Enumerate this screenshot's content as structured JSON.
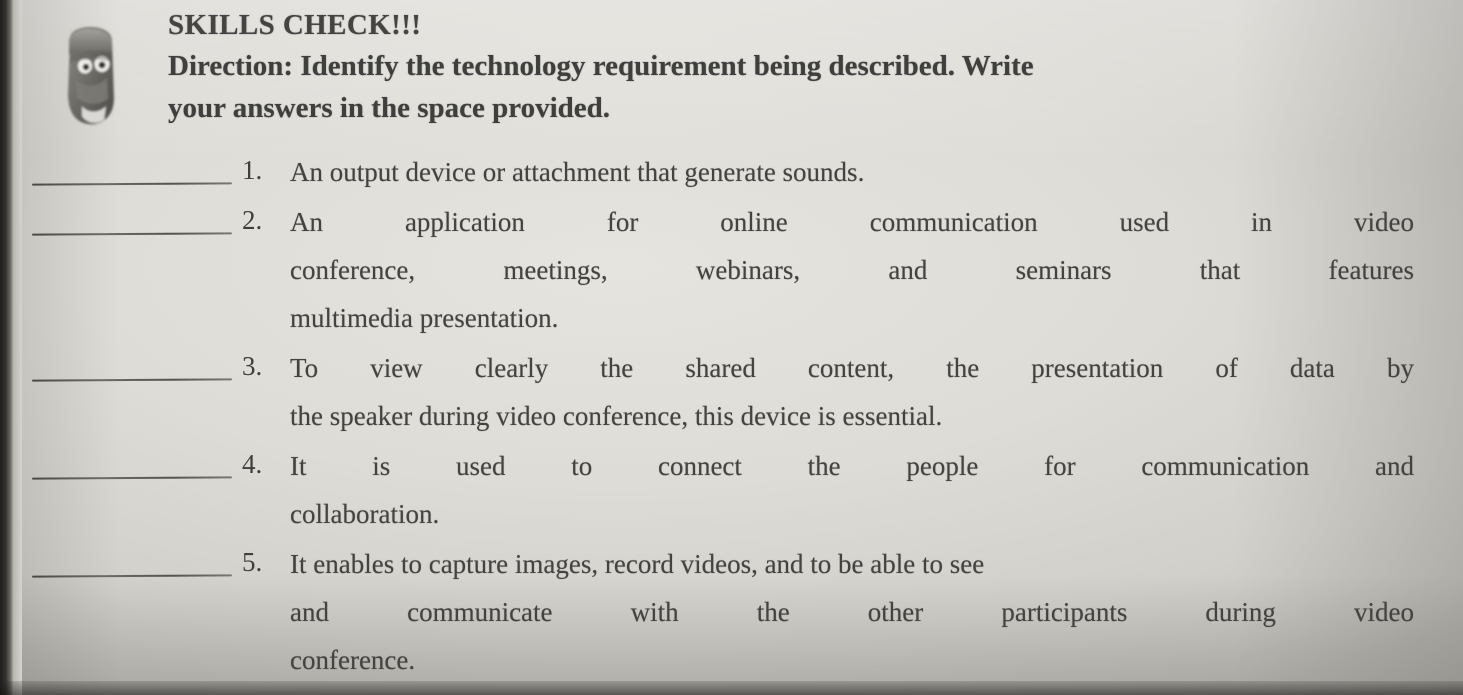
{
  "document": {
    "type": "worksheet-scan",
    "icon_name": "cartoon-character-illustration",
    "title": "SKILLS CHECK!!!",
    "direction": {
      "line1": "Direction: Identify the technology requirement being described. Write",
      "line2": "your answers in the space provided."
    },
    "colors": {
      "paper": "#e1dfda",
      "ink": "#43413e",
      "binding_strip": "#24231f"
    },
    "questions": [
      {
        "number": "1.",
        "answer_blank": "",
        "lines": [
          {
            "text": "An output device or attachment that generate sounds.",
            "justify": false
          }
        ]
      },
      {
        "number": "2.",
        "answer_blank": "",
        "lines": [
          {
            "text": "An application for online communication used in video",
            "justify": true
          },
          {
            "text": "conference, meetings, webinars, and seminars that features",
            "justify": true
          },
          {
            "text": "multimedia presentation.",
            "justify": false
          }
        ]
      },
      {
        "number": "3.",
        "answer_blank": "",
        "lines": [
          {
            "text": "To view clearly the shared content, the presentation of data by",
            "justify": true
          },
          {
            "text": "the speaker during video conference, this device is essential.",
            "justify": false
          }
        ]
      },
      {
        "number": "4.",
        "answer_blank": "",
        "lines": [
          {
            "text": "It is used to connect the people for communication and",
            "justify": true
          },
          {
            "text": "collaboration.",
            "justify": false
          }
        ]
      },
      {
        "number": "5.",
        "answer_blank": "",
        "lines": [
          {
            "text": "It enables to capture images, record videos, and to be able to see",
            "justify": false
          },
          {
            "text": "and communicate with the other participants during video",
            "justify": true
          },
          {
            "text": "conference.",
            "justify": false
          }
        ]
      }
    ]
  }
}
